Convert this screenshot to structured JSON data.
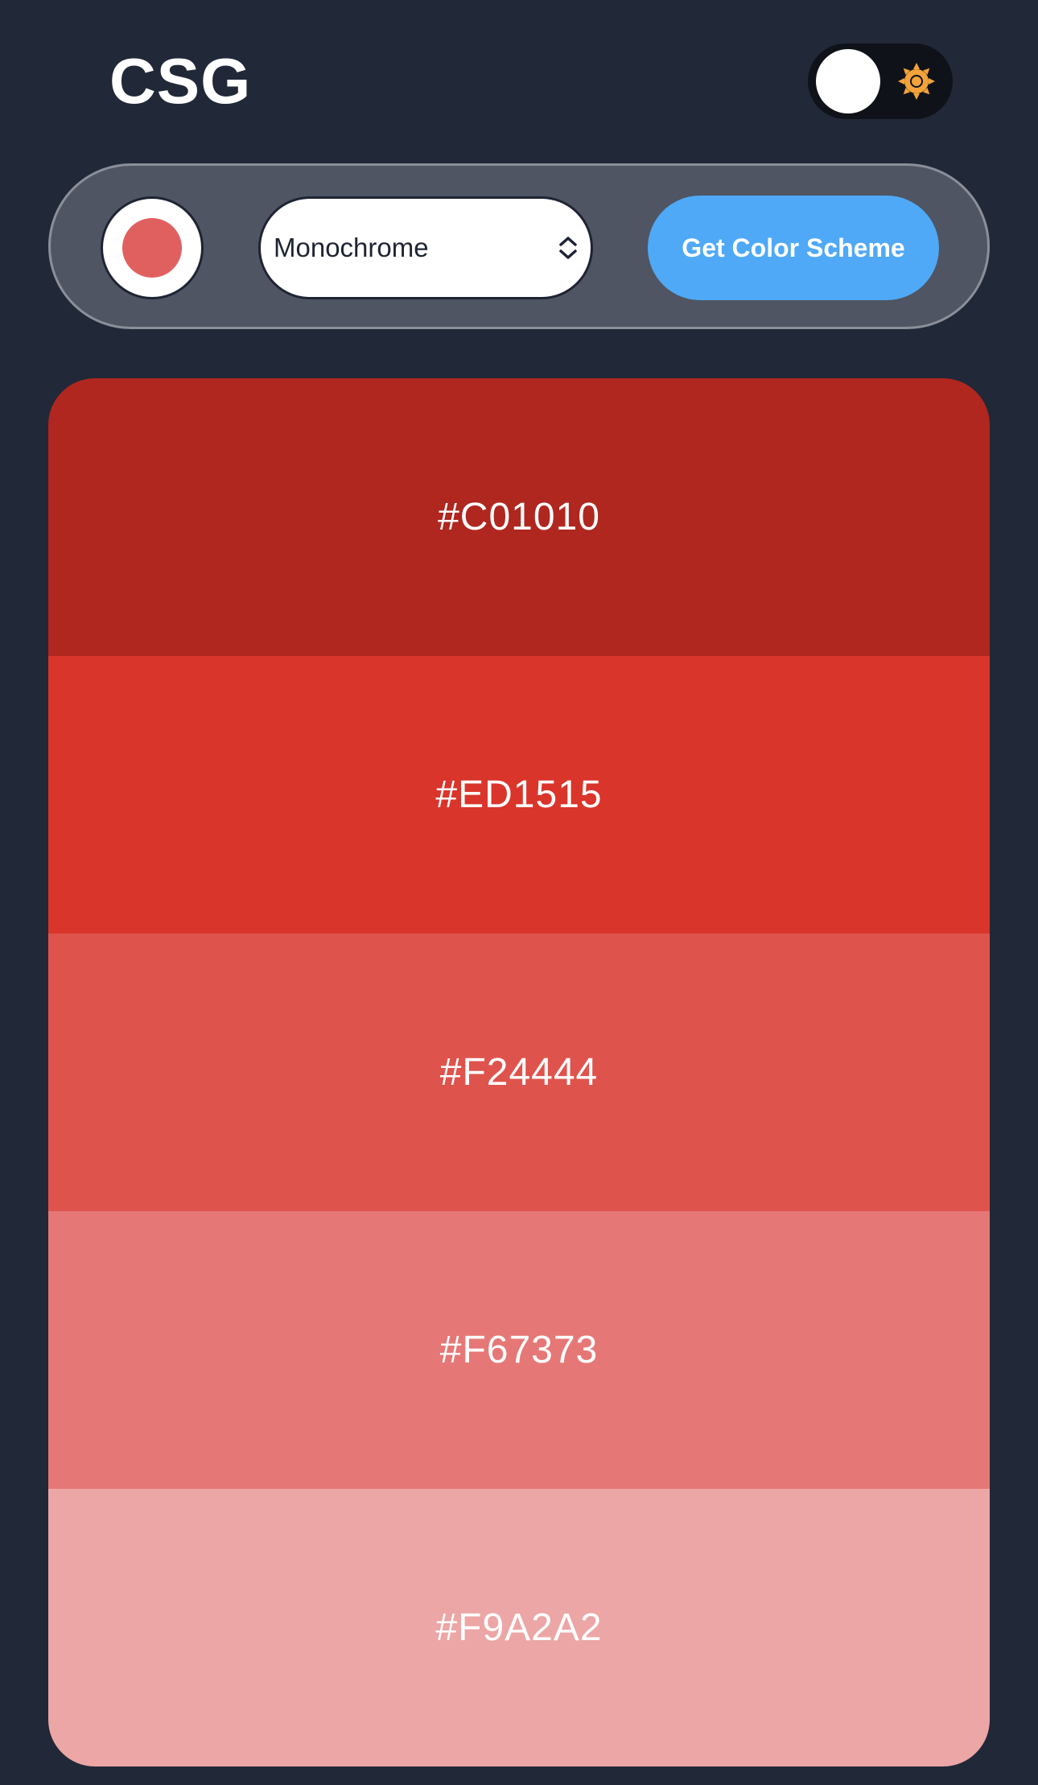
{
  "header": {
    "title": "CSG",
    "theme_toggle": {
      "state": "dark",
      "icon": "sun-icon",
      "icon_color": "#F2A33A"
    }
  },
  "controls": {
    "seed_color": "#E06060",
    "mode": {
      "selected": "Monochrome",
      "icon": "chevron-up-down-icon"
    },
    "submit_label": "Get Color Scheme",
    "accent_color": "#4FA9F6"
  },
  "palette": {
    "colors": [
      {
        "hex": "#C01010",
        "display_color": "#AF271F"
      },
      {
        "hex": "#ED1515",
        "display_color": "#DA352B"
      },
      {
        "hex": "#F24444",
        "display_color": "#DF534D"
      },
      {
        "hex": "#F67373",
        "display_color": "#E57876"
      },
      {
        "hex": "#F9A2A2",
        "display_color": "#ECA6A5"
      }
    ]
  }
}
